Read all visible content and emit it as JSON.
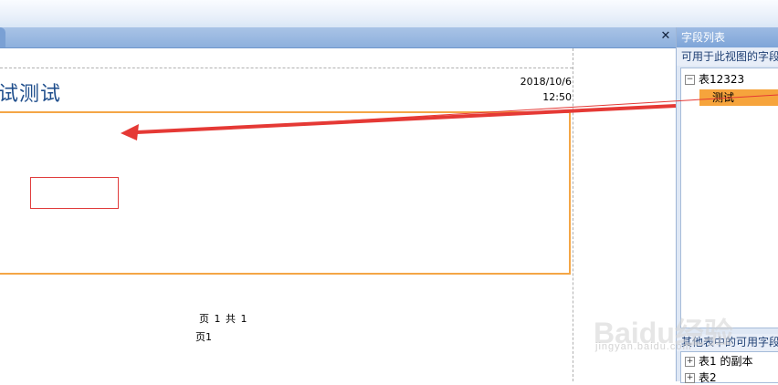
{
  "document_tab": {
    "close_glyph": "✕"
  },
  "report": {
    "title": "试测试",
    "date": "2018/10/6",
    "time": "12:50",
    "page_label": "页1",
    "page_footer": "页 1 共 1"
  },
  "field_list": {
    "header": "字段列表",
    "available_label": "可用于此视图的字段",
    "tables": [
      {
        "expander": "−",
        "name": "表12323",
        "fields": [
          "测试"
        ]
      }
    ],
    "other_label": "其他表中的可用字段",
    "other_tables": [
      {
        "expander": "+",
        "name": "表1 的副本"
      },
      {
        "expander": "+",
        "name": "表2"
      }
    ]
  },
  "watermark": {
    "brand": "Baidu经验",
    "site": "jingyan.baidu.com"
  },
  "colors": {
    "accent_orange": "#f6a43c",
    "arrow_red": "#e53935",
    "title_blue": "#1f4e8c",
    "panel_blue": "#7ea5d8"
  }
}
